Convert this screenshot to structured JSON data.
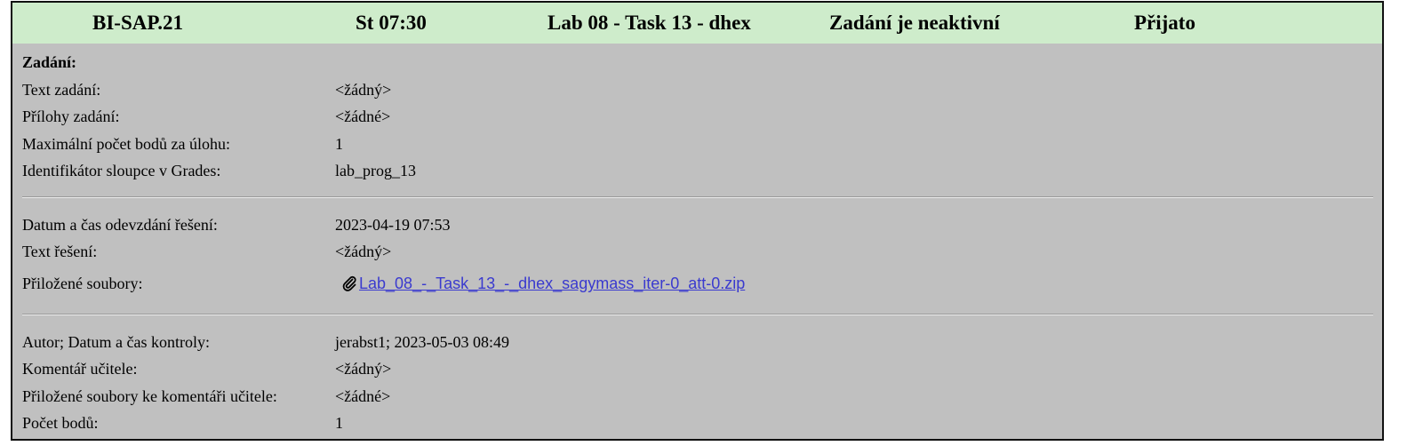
{
  "header": {
    "course": "BI-SAP.21",
    "slot": "St 07:30",
    "task": "Lab 08 - Task 13 - dhex",
    "state": "Zadání je neaktivní",
    "result": "Přijato"
  },
  "assignment": {
    "heading": "Zadání:",
    "rows": [
      {
        "label": "Text zadání:",
        "value": "<žádný>"
      },
      {
        "label": "Přílohy zadání:",
        "value": "<žádné>"
      },
      {
        "label": "Maximální počet bodů za úlohu:",
        "value": "1"
      },
      {
        "label": "Identifikátor sloupce v Grades:",
        "value": "lab_prog_13"
      }
    ]
  },
  "submission": {
    "rows": [
      {
        "label": "Datum a čas odevzdání řešení:",
        "value": "2023-04-19 07:53"
      },
      {
        "label": "Text řešení:",
        "value": "<žádný>"
      }
    ],
    "files_label": "Přiložené soubory:",
    "file_icon": "paperclip-icon",
    "file_name": "Lab_08_-_Task_13_-_dhex_sagymass_iter-0_att-0.zip"
  },
  "review": {
    "rows": [
      {
        "label": "Autor; Datum a čas kontroly:",
        "value": "jerabst1; 2023-05-03 08:49"
      },
      {
        "label": "Komentář učitele:",
        "value": "<žádný>"
      },
      {
        "label": "Přiložené soubory ke komentáři učitele:",
        "value": "<žádné>"
      },
      {
        "label": "Počet bodů:",
        "value": "1"
      }
    ]
  },
  "colors": {
    "header_bg": "#ceeccb",
    "panel_bg": "#c0c0c0",
    "link": "#3a3acf"
  }
}
